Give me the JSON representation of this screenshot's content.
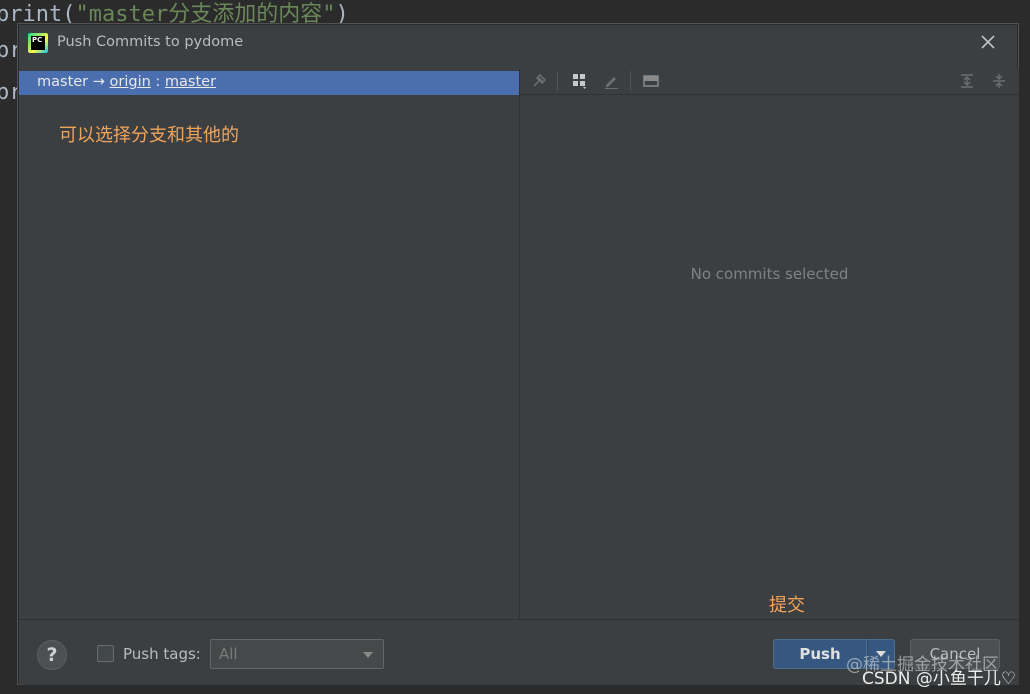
{
  "editor": {
    "line1_fn": "print(",
    "line1_str": "\"master分支添加的内容\"",
    "line1_end": ")",
    "line2": "pr",
    "line3": "pr"
  },
  "dialog": {
    "title": "Push Commits to pydome",
    "app_icon_text": "PC",
    "close_icon": "close-icon"
  },
  "branch": {
    "local": "master",
    "arrow": "→",
    "remote": "origin",
    "separator": ":",
    "remote_branch": "master"
  },
  "annotations": {
    "left": "可以选择分支和其他的",
    "right": "提交"
  },
  "commits_panel": {
    "empty_text": "No commits selected"
  },
  "toolbar": {
    "icons": [
      "pin-icon",
      "group-icon",
      "edit-icon",
      "preview-icon",
      "expand-all-icon",
      "collapse-all-icon"
    ]
  },
  "footer": {
    "help_label": "?",
    "push_tags_label": "Push tags:",
    "push_tags_checked": false,
    "tags_select_value": "All",
    "push_label": "Push",
    "cancel_label": "Cancel"
  },
  "watermark": {
    "line1": "@稀土掘金技术社区",
    "line2": "CSDN @小鱼干儿♡"
  },
  "colors": {
    "selection": "#4b6eaf",
    "annotation": "#f0a45a",
    "primary_button": "#365880"
  }
}
